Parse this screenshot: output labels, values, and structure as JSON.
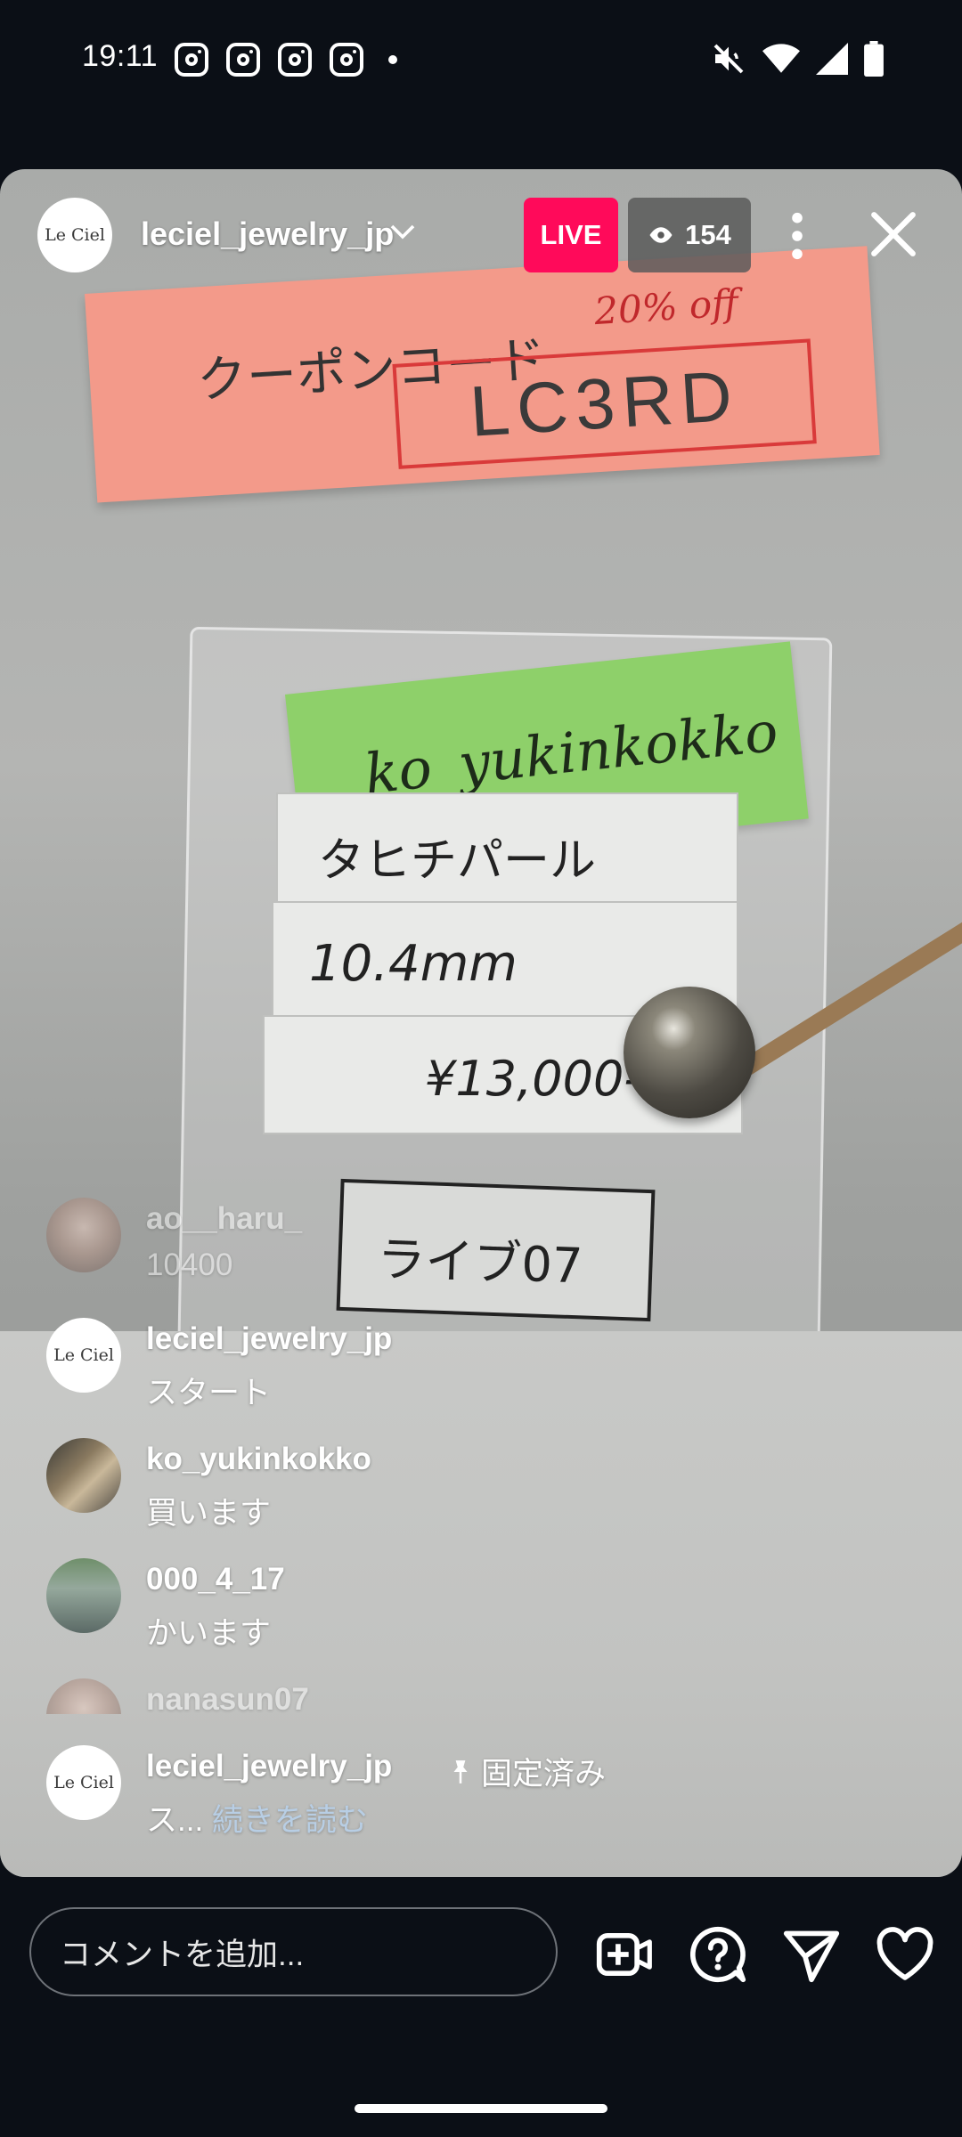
{
  "status_bar": {
    "time": "19:11",
    "left_icons": [
      "instagram-icon",
      "instagram-icon",
      "instagram-icon",
      "instagram-icon",
      "dot-icon"
    ],
    "right_icons": [
      "mute-icon",
      "wifi-icon",
      "signal-icon",
      "battery-icon"
    ]
  },
  "live": {
    "host_avatar_text": "Le Ciel",
    "host_username": "leciel_jewelry_jp",
    "live_badge": "LIVE",
    "viewer_count": "154"
  },
  "video": {
    "coupon_label": "クーポンコード",
    "discount": "20% off",
    "coupon_code": "LC3RD",
    "buyer_note": "ko_yukinkokko",
    "item_name": "タヒチパール",
    "item_size": "10.4mm",
    "item_price": "¥13,000-",
    "live_number": "ライブ07"
  },
  "comments": [
    {
      "username": "ao__haru_",
      "text": "10400",
      "avatar": "photo"
    },
    {
      "username": "leciel_jewelry_jp",
      "text": "スタート",
      "avatar": "Le Ciel"
    },
    {
      "username": "ko_yukinkokko",
      "text": "買います",
      "avatar": "photo"
    },
    {
      "username": "000_4_17",
      "text": "かいます",
      "avatar": "photo"
    },
    {
      "username": "nanasun07",
      "text": "",
      "avatar": "photo"
    }
  ],
  "pinned_comment": {
    "username": "leciel_jewelry_jp",
    "pinned_label": "固定済み",
    "text": "ス...",
    "read_more": "続きを読む",
    "avatar_text": "Le Ciel"
  },
  "bottom_bar": {
    "comment_placeholder": "コメントを追加...",
    "icons": [
      "video-add-icon",
      "question-icon",
      "send-icon",
      "heart-icon"
    ]
  },
  "colors": {
    "live_badge": "#ff0a5a",
    "background": "#0b0f16"
  }
}
